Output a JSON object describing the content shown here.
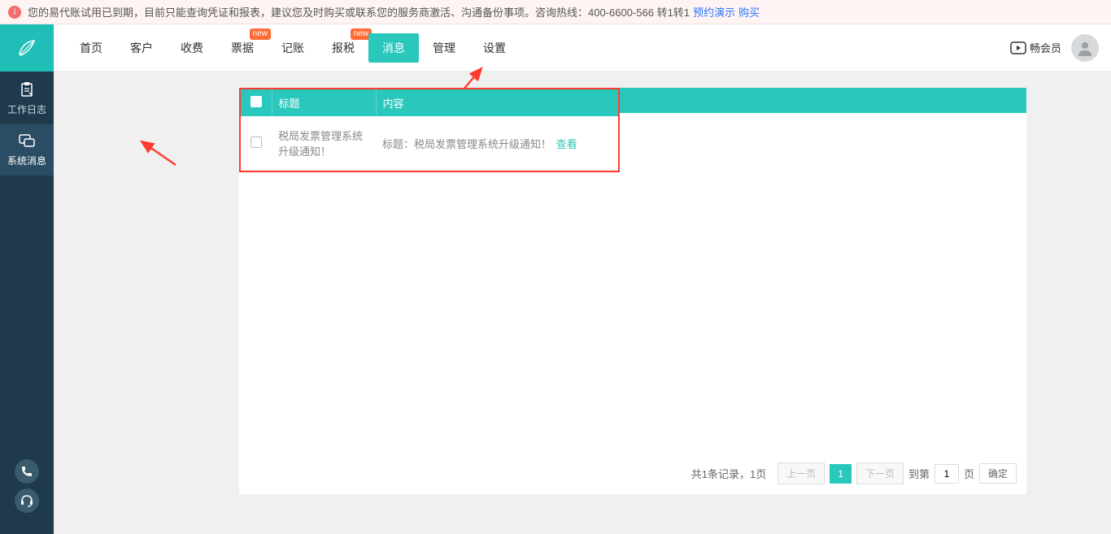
{
  "banner": {
    "icon_label": "i",
    "text": "您的易代账试用已到期，目前只能查询凭证和报表，建议您及时购买或联系您的服务商激活、沟通备份事项。咨询热线：400-6600-566 转1转1",
    "link_demo": "预约演示",
    "link_buy": "购买"
  },
  "sidebar": {
    "items": [
      {
        "label": "工作日志",
        "icon": "log"
      },
      {
        "label": "系统消息",
        "icon": "msg"
      }
    ]
  },
  "nav": {
    "items": [
      {
        "label": "首页"
      },
      {
        "label": "客户"
      },
      {
        "label": "收费"
      },
      {
        "label": "票据",
        "badge": "new"
      },
      {
        "label": "记账"
      },
      {
        "label": "报税",
        "badge": "new"
      },
      {
        "label": "消息",
        "active": true
      },
      {
        "label": "管理"
      },
      {
        "label": "设置"
      }
    ],
    "member_label": "畅会员"
  },
  "table": {
    "headers": {
      "title": "标题",
      "content": "内容"
    },
    "rows": [
      {
        "title": "税局发票管理系统升级通知！",
        "content_prefix": "标题：税局发票管理系统升级通知！",
        "view_label": "查看"
      }
    ]
  },
  "pagination": {
    "info": "共1条记录，1页",
    "prev": "上一页",
    "next": "下一页",
    "current": "1",
    "goto_prefix": "到第",
    "goto_suffix": "页",
    "goto_value": "1",
    "confirm": "确定"
  }
}
